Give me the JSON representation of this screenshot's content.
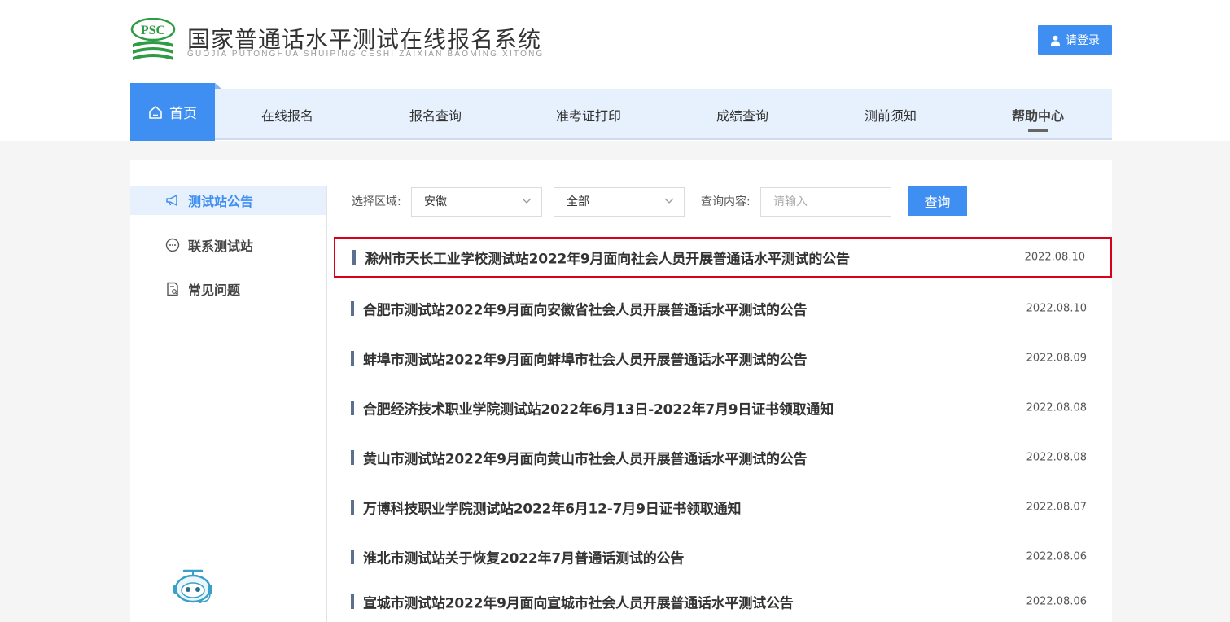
{
  "header": {
    "site_title": "国家普通话水平测试在线报名系统",
    "site_subtitle": "GUOJIA PUTONGHUA SHUIPING CESHI ZAIXIAN BAOMING XITONG",
    "logo_text": "PSC",
    "login_label": "请登录"
  },
  "nav": {
    "items": [
      {
        "label": "首页"
      },
      {
        "label": "在线报名"
      },
      {
        "label": "报名查询"
      },
      {
        "label": "准考证打印"
      },
      {
        "label": "成绩查询"
      },
      {
        "label": "测前须知"
      },
      {
        "label": "帮助中心"
      }
    ],
    "active": "帮助中心"
  },
  "sidebar": {
    "items": [
      {
        "label": "测试站公告",
        "icon": "megaphone-icon"
      },
      {
        "label": "联系测试站",
        "icon": "chat-icon"
      },
      {
        "label": "常见问题",
        "icon": "document-question-icon"
      }
    ],
    "active": "测试站公告"
  },
  "filters": {
    "region_label": "选择区域:",
    "region_value": "安徽",
    "type_value": "全部",
    "query_label": "查询内容:",
    "query_placeholder": "请输入",
    "query_button": "查询"
  },
  "notices": [
    {
      "title": "滁州市天长工业学校测试站2022年9月面向社会人员开展普通话水平测试的公告",
      "date": "2022.08.10",
      "highlighted": true
    },
    {
      "title": "合肥市测试站2022年9月面向安徽省社会人员开展普通话水平测试的公告",
      "date": "2022.08.10"
    },
    {
      "title": "蚌埠市测试站2022年9月面向蚌埠市社会人员开展普通话水平测试的公告",
      "date": "2022.08.09"
    },
    {
      "title": "合肥经济技术职业学院测试站2022年6月13日-2022年7月9日证书领取通知",
      "date": "2022.08.08"
    },
    {
      "title": "黄山市测试站2022年9月面向黄山市社会人员开展普通话水平测试的公告",
      "date": "2022.08.08"
    },
    {
      "title": "万博科技职业学院测试站2022年6月12-7月9日证书领取通知",
      "date": "2022.08.07"
    },
    {
      "title": "淮北市测试站关于恢复2022年7月普通话测试的公告",
      "date": "2022.08.06"
    },
    {
      "title": "宣城市测试站2022年9月面向宣城市社会人员开展普通话水平测试公告",
      "date": "2022.08.06"
    }
  ],
  "colors": {
    "accent": "#3f8ef2",
    "nav_bg": "#e7f1fd",
    "highlight_border": "#d9001b",
    "logo_green": "#2e9b45"
  }
}
